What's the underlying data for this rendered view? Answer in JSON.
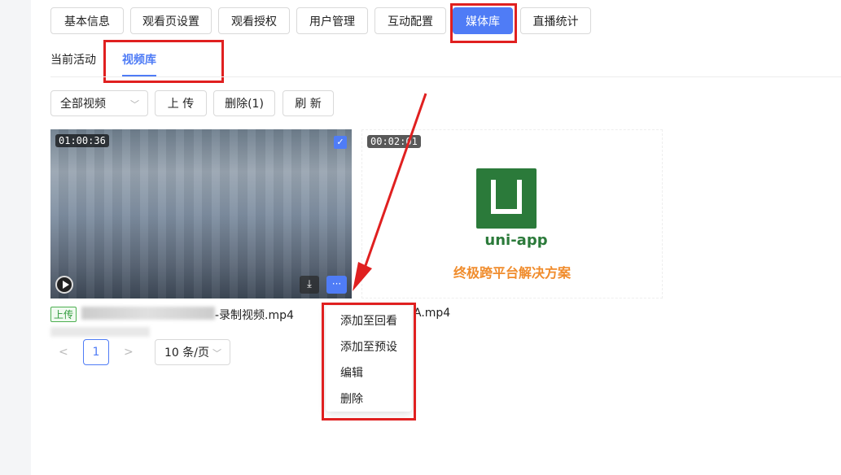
{
  "top_tabs": [
    "基本信息",
    "观看页设置",
    "观看授权",
    "用户管理",
    "互动配置",
    "媒体库",
    "直播统计"
  ],
  "sub_tabs": [
    "当前活动",
    "视频库"
  ],
  "toolbar": {
    "filter_value": "全部视频",
    "upload_label": "上 传",
    "delete_label": "删除(1)",
    "refresh_label": "刷 新"
  },
  "videos": [
    {
      "duration": "01:00:36",
      "badge": "上传",
      "filename_suffix": "-录制视频.mp4",
      "selected": true
    },
    {
      "duration": "00:02:01",
      "filename_suffix": "A.mp4",
      "logo_text": "uni-app",
      "slogan": "终极跨平台解决方案"
    }
  ],
  "pagination": {
    "current_page": "1",
    "page_size": "10 条/页"
  },
  "context_menu": [
    "添加至回看",
    "添加至预设",
    "编辑",
    "删除"
  ],
  "colors": {
    "accent": "#4f7cf6",
    "highlight": "#e02020",
    "logo_green": "#2b7a3a",
    "slogan_orange": "#f08c2c"
  }
}
